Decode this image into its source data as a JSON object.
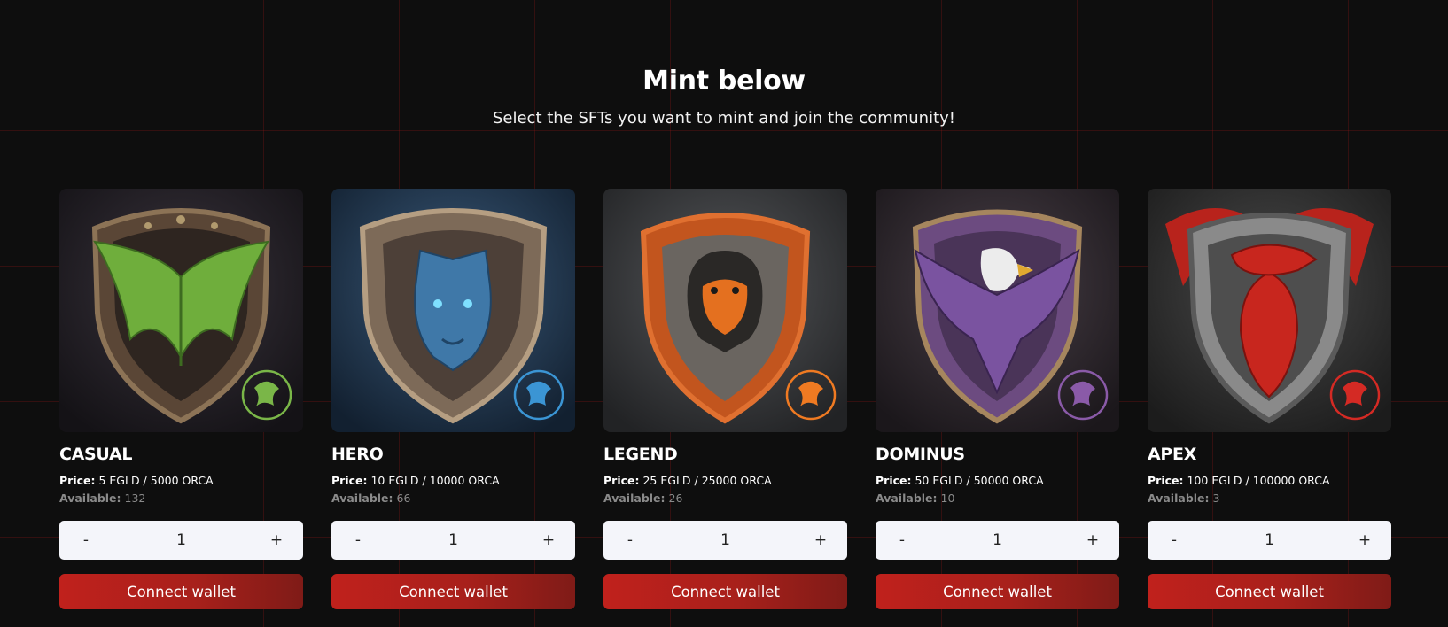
{
  "header": {
    "title": "Mint below",
    "subtitle": "Select the SFTs you want to mint and join the community!"
  },
  "labels": {
    "price": "Price:",
    "available": "Available:",
    "decrement": "-",
    "increment": "+"
  },
  "cards": [
    {
      "name": "CASUAL",
      "price": "5 EGLD / 5000 ORCA",
      "available": "132",
      "quantity": "1",
      "button": "Connect wallet",
      "badge": "CASUAL - Orca.gg",
      "accent": "#7ab648",
      "icon": "bat-shield-icon"
    },
    {
      "name": "HERO",
      "price": "10 EGLD / 10000 ORCA",
      "available": "66",
      "quantity": "1",
      "button": "Connect wallet",
      "badge": "HERO - Orca.gg",
      "accent": "#3b95d4",
      "icon": "panther-shield-icon"
    },
    {
      "name": "LEGEND",
      "price": "25 EGLD / 25000 ORCA",
      "available": "26",
      "quantity": "1",
      "button": "Connect wallet",
      "badge": "LEGEND - Orca.gg",
      "accent": "#ef7a22",
      "icon": "gorilla-shield-icon"
    },
    {
      "name": "DOMINUS",
      "price": "50 EGLD / 50000 ORCA",
      "available": "10",
      "quantity": "1",
      "button": "Connect wallet",
      "badge": "DOMINUS - Orca.gg",
      "accent": "#8a5aa8",
      "icon": "eagle-shield-icon"
    },
    {
      "name": "APEX",
      "price": "100 EGLD / 100000 ORCA",
      "available": "3",
      "quantity": "1",
      "button": "Connect wallet",
      "badge": "APEX - Orca.gg",
      "accent": "#d42a24",
      "icon": "dragon-shield-icon"
    }
  ]
}
